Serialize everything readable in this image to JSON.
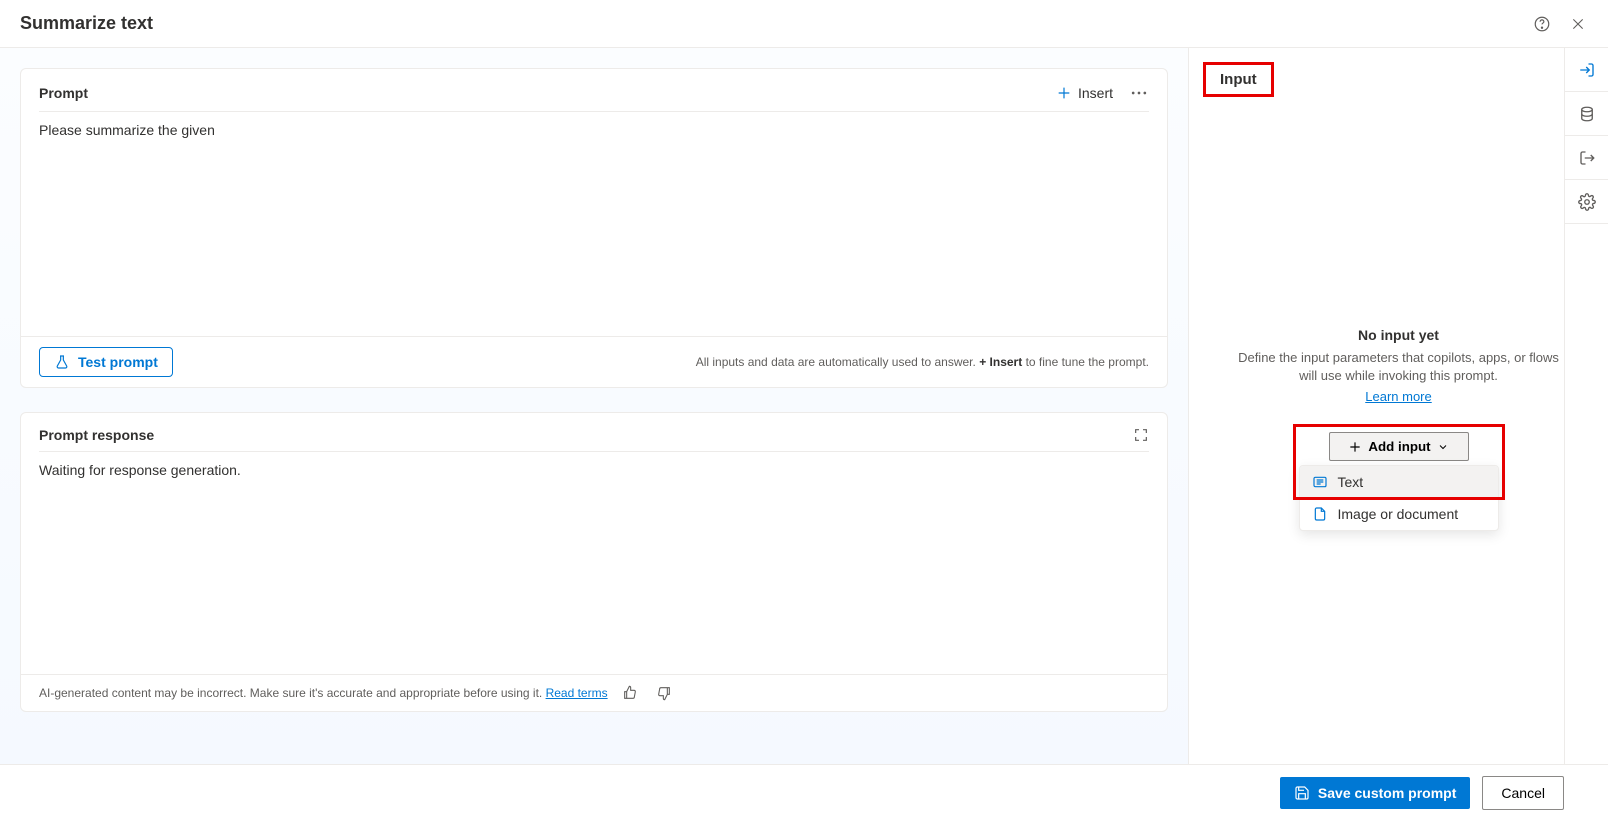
{
  "header": {
    "title": "Summarize text"
  },
  "prompt": {
    "title": "Prompt",
    "insert_label": "Insert",
    "body": "Please summarize the given",
    "test_label": "Test prompt",
    "hint_prefix": "All inputs and data are automatically used to answer. ",
    "hint_plus": "+",
    "hint_insert": "Insert",
    "hint_suffix": " to fine tune the prompt."
  },
  "response": {
    "title": "Prompt response",
    "body": "Waiting for response generation.",
    "disclaimer_text": "AI-generated content may be incorrect. Make sure it's accurate and appropriate before using it. ",
    "read_terms": "Read terms"
  },
  "input_panel": {
    "tab_label": "Input",
    "empty_title": "No input yet",
    "empty_desc": "Define the input parameters that copilots, apps, or flows will use while invoking this prompt.",
    "learn_more": "Learn more",
    "add_input_label": "Add input",
    "options": {
      "text": "Text",
      "image": "Image or document"
    }
  },
  "footer": {
    "save_label": "Save custom prompt",
    "cancel_label": "Cancel"
  }
}
